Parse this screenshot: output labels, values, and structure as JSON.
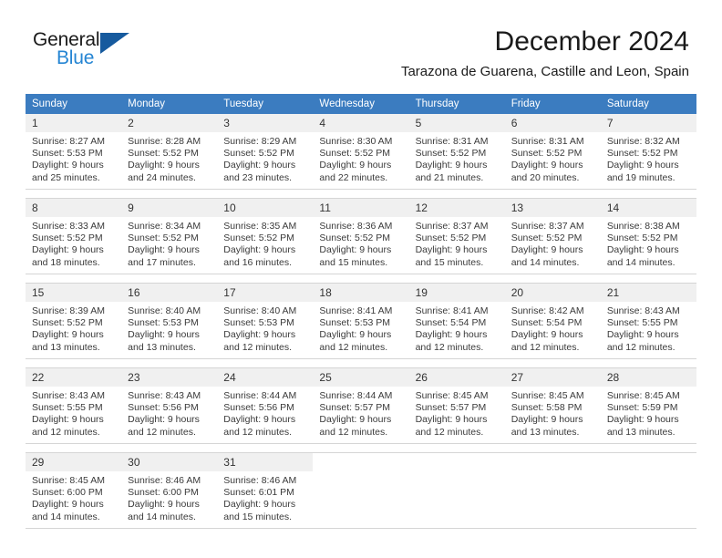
{
  "brand": {
    "name_part1": "General",
    "name_part2": "Blue",
    "logo_icon": "flag-triangle-icon",
    "accent_color": "#2585d3",
    "flag_color": "#165a9e"
  },
  "header": {
    "month_title": "December 2024",
    "location": "Tarazona de Guarena, Castille and Leon, Spain",
    "header_bg_color": "#3b7cc0",
    "daynum_bg_color": "#f0f0f0"
  },
  "weekday_headers": [
    "Sunday",
    "Monday",
    "Tuesday",
    "Wednesday",
    "Thursday",
    "Friday",
    "Saturday"
  ],
  "weeks": [
    {
      "days": [
        {
          "day": "1",
          "sunrise": "Sunrise: 8:27 AM",
          "sunset": "Sunset: 5:53 PM",
          "daylight_line1": "Daylight: 9 hours",
          "daylight_line2": "and 25 minutes."
        },
        {
          "day": "2",
          "sunrise": "Sunrise: 8:28 AM",
          "sunset": "Sunset: 5:52 PM",
          "daylight_line1": "Daylight: 9 hours",
          "daylight_line2": "and 24 minutes."
        },
        {
          "day": "3",
          "sunrise": "Sunrise: 8:29 AM",
          "sunset": "Sunset: 5:52 PM",
          "daylight_line1": "Daylight: 9 hours",
          "daylight_line2": "and 23 minutes."
        },
        {
          "day": "4",
          "sunrise": "Sunrise: 8:30 AM",
          "sunset": "Sunset: 5:52 PM",
          "daylight_line1": "Daylight: 9 hours",
          "daylight_line2": "and 22 minutes."
        },
        {
          "day": "5",
          "sunrise": "Sunrise: 8:31 AM",
          "sunset": "Sunset: 5:52 PM",
          "daylight_line1": "Daylight: 9 hours",
          "daylight_line2": "and 21 minutes."
        },
        {
          "day": "6",
          "sunrise": "Sunrise: 8:31 AM",
          "sunset": "Sunset: 5:52 PM",
          "daylight_line1": "Daylight: 9 hours",
          "daylight_line2": "and 20 minutes."
        },
        {
          "day": "7",
          "sunrise": "Sunrise: 8:32 AM",
          "sunset": "Sunset: 5:52 PM",
          "daylight_line1": "Daylight: 9 hours",
          "daylight_line2": "and 19 minutes."
        }
      ]
    },
    {
      "days": [
        {
          "day": "8",
          "sunrise": "Sunrise: 8:33 AM",
          "sunset": "Sunset: 5:52 PM",
          "daylight_line1": "Daylight: 9 hours",
          "daylight_line2": "and 18 minutes."
        },
        {
          "day": "9",
          "sunrise": "Sunrise: 8:34 AM",
          "sunset": "Sunset: 5:52 PM",
          "daylight_line1": "Daylight: 9 hours",
          "daylight_line2": "and 17 minutes."
        },
        {
          "day": "10",
          "sunrise": "Sunrise: 8:35 AM",
          "sunset": "Sunset: 5:52 PM",
          "daylight_line1": "Daylight: 9 hours",
          "daylight_line2": "and 16 minutes."
        },
        {
          "day": "11",
          "sunrise": "Sunrise: 8:36 AM",
          "sunset": "Sunset: 5:52 PM",
          "daylight_line1": "Daylight: 9 hours",
          "daylight_line2": "and 15 minutes."
        },
        {
          "day": "12",
          "sunrise": "Sunrise: 8:37 AM",
          "sunset": "Sunset: 5:52 PM",
          "daylight_line1": "Daylight: 9 hours",
          "daylight_line2": "and 15 minutes."
        },
        {
          "day": "13",
          "sunrise": "Sunrise: 8:37 AM",
          "sunset": "Sunset: 5:52 PM",
          "daylight_line1": "Daylight: 9 hours",
          "daylight_line2": "and 14 minutes."
        },
        {
          "day": "14",
          "sunrise": "Sunrise: 8:38 AM",
          "sunset": "Sunset: 5:52 PM",
          "daylight_line1": "Daylight: 9 hours",
          "daylight_line2": "and 14 minutes."
        }
      ]
    },
    {
      "days": [
        {
          "day": "15",
          "sunrise": "Sunrise: 8:39 AM",
          "sunset": "Sunset: 5:52 PM",
          "daylight_line1": "Daylight: 9 hours",
          "daylight_line2": "and 13 minutes."
        },
        {
          "day": "16",
          "sunrise": "Sunrise: 8:40 AM",
          "sunset": "Sunset: 5:53 PM",
          "daylight_line1": "Daylight: 9 hours",
          "daylight_line2": "and 13 minutes."
        },
        {
          "day": "17",
          "sunrise": "Sunrise: 8:40 AM",
          "sunset": "Sunset: 5:53 PM",
          "daylight_line1": "Daylight: 9 hours",
          "daylight_line2": "and 12 minutes."
        },
        {
          "day": "18",
          "sunrise": "Sunrise: 8:41 AM",
          "sunset": "Sunset: 5:53 PM",
          "daylight_line1": "Daylight: 9 hours",
          "daylight_line2": "and 12 minutes."
        },
        {
          "day": "19",
          "sunrise": "Sunrise: 8:41 AM",
          "sunset": "Sunset: 5:54 PM",
          "daylight_line1": "Daylight: 9 hours",
          "daylight_line2": "and 12 minutes."
        },
        {
          "day": "20",
          "sunrise": "Sunrise: 8:42 AM",
          "sunset": "Sunset: 5:54 PM",
          "daylight_line1": "Daylight: 9 hours",
          "daylight_line2": "and 12 minutes."
        },
        {
          "day": "21",
          "sunrise": "Sunrise: 8:43 AM",
          "sunset": "Sunset: 5:55 PM",
          "daylight_line1": "Daylight: 9 hours",
          "daylight_line2": "and 12 minutes."
        }
      ]
    },
    {
      "days": [
        {
          "day": "22",
          "sunrise": "Sunrise: 8:43 AM",
          "sunset": "Sunset: 5:55 PM",
          "daylight_line1": "Daylight: 9 hours",
          "daylight_line2": "and 12 minutes."
        },
        {
          "day": "23",
          "sunrise": "Sunrise: 8:43 AM",
          "sunset": "Sunset: 5:56 PM",
          "daylight_line1": "Daylight: 9 hours",
          "daylight_line2": "and 12 minutes."
        },
        {
          "day": "24",
          "sunrise": "Sunrise: 8:44 AM",
          "sunset": "Sunset: 5:56 PM",
          "daylight_line1": "Daylight: 9 hours",
          "daylight_line2": "and 12 minutes."
        },
        {
          "day": "25",
          "sunrise": "Sunrise: 8:44 AM",
          "sunset": "Sunset: 5:57 PM",
          "daylight_line1": "Daylight: 9 hours",
          "daylight_line2": "and 12 minutes."
        },
        {
          "day": "26",
          "sunrise": "Sunrise: 8:45 AM",
          "sunset": "Sunset: 5:57 PM",
          "daylight_line1": "Daylight: 9 hours",
          "daylight_line2": "and 12 minutes."
        },
        {
          "day": "27",
          "sunrise": "Sunrise: 8:45 AM",
          "sunset": "Sunset: 5:58 PM",
          "daylight_line1": "Daylight: 9 hours",
          "daylight_line2": "and 13 minutes."
        },
        {
          "day": "28",
          "sunrise": "Sunrise: 8:45 AM",
          "sunset": "Sunset: 5:59 PM",
          "daylight_line1": "Daylight: 9 hours",
          "daylight_line2": "and 13 minutes."
        }
      ]
    },
    {
      "days": [
        {
          "day": "29",
          "sunrise": "Sunrise: 8:45 AM",
          "sunset": "Sunset: 6:00 PM",
          "daylight_line1": "Daylight: 9 hours",
          "daylight_line2": "and 14 minutes."
        },
        {
          "day": "30",
          "sunrise": "Sunrise: 8:46 AM",
          "sunset": "Sunset: 6:00 PM",
          "daylight_line1": "Daylight: 9 hours",
          "daylight_line2": "and 14 minutes."
        },
        {
          "day": "31",
          "sunrise": "Sunrise: 8:46 AM",
          "sunset": "Sunset: 6:01 PM",
          "daylight_line1": "Daylight: 9 hours",
          "daylight_line2": "and 15 minutes."
        },
        {
          "day": "",
          "sunrise": "",
          "sunset": "",
          "daylight_line1": "",
          "daylight_line2": ""
        },
        {
          "day": "",
          "sunrise": "",
          "sunset": "",
          "daylight_line1": "",
          "daylight_line2": ""
        },
        {
          "day": "",
          "sunrise": "",
          "sunset": "",
          "daylight_line1": "",
          "daylight_line2": ""
        },
        {
          "day": "",
          "sunrise": "",
          "sunset": "",
          "daylight_line1": "",
          "daylight_line2": ""
        }
      ]
    }
  ]
}
